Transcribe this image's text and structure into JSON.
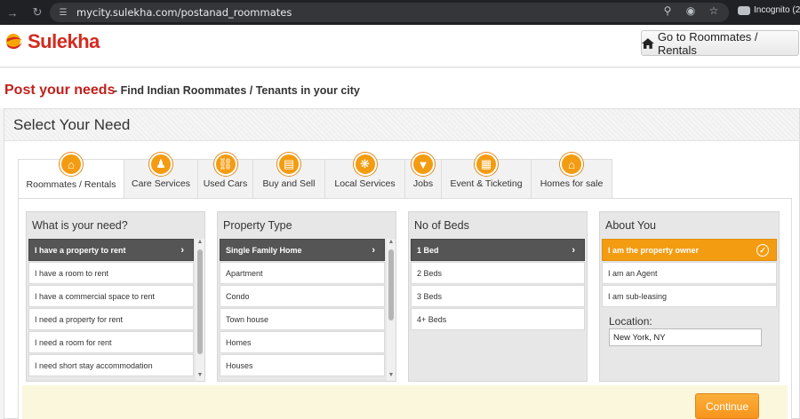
{
  "browser": {
    "url": "mycity.sulekha.com/postanad_roommates",
    "incognito_label": "Incognito (2)"
  },
  "header": {
    "logo_text": "Sulekha",
    "go_button_label": "Go to Roommates / Rentals"
  },
  "subheader": {
    "title": "Post your needs",
    "subtitle": "- Find Indian Roommates / Tenants in your city"
  },
  "panel": {
    "title": "Select Your Need"
  },
  "tabs": [
    {
      "label": "Roommates / Rentals",
      "icon": "home-icon",
      "active": true
    },
    {
      "label": "Care Services",
      "icon": "people-icon"
    },
    {
      "label": "Used Cars",
      "icon": "car-icon"
    },
    {
      "label": "Buy and Sell",
      "icon": "cart-icon"
    },
    {
      "label": "Local Services",
      "icon": "compass-icon"
    },
    {
      "label": "Jobs",
      "icon": "tie-icon"
    },
    {
      "label": "Event & Ticketing",
      "icon": "calendar-icon"
    },
    {
      "label": "Homes for sale",
      "icon": "home-icon"
    }
  ],
  "columns": {
    "need": {
      "heading": "What is your need?",
      "options": [
        "I have a property to rent",
        "I have a room to rent",
        "I have a commercial space to rent",
        "I need a property for rent",
        "I need a room for rent",
        "I need short stay accommodation"
      ],
      "selected": 0
    },
    "property": {
      "heading": "Property Type",
      "options": [
        "Single Family Home",
        "Apartment",
        "Condo",
        "Town house",
        "Homes",
        "Houses"
      ],
      "selected": 0
    },
    "beds": {
      "heading": "No of Beds",
      "options": [
        "1 Bed",
        "2 Beds",
        "3 Beds",
        "4+ Beds"
      ],
      "selected": 0
    },
    "about": {
      "heading": "About You",
      "options": [
        "I am the property owner",
        "I am an Agent",
        "I am sub-leasing"
      ],
      "selected": 0,
      "location_label": "Location:",
      "location_value": "New York, NY"
    }
  },
  "actions": {
    "continue_label": "Continue"
  },
  "colors": {
    "brand_red": "#d42a1f",
    "accent_orange": "#f39c12",
    "selected_dark": "#555555"
  }
}
